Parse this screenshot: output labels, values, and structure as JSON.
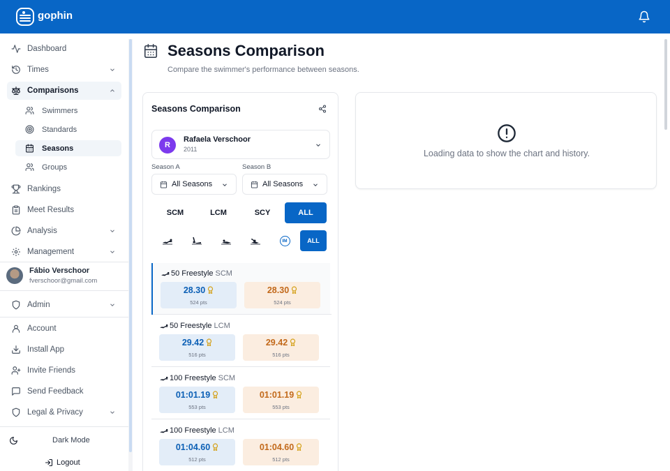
{
  "app": {
    "brand": "gophin"
  },
  "sidebar": {
    "items": [
      {
        "label": "Dashboard",
        "icon": "activity-icon"
      },
      {
        "label": "Times",
        "icon": "history-icon"
      },
      {
        "label": "Comparisons",
        "icon": "scale-icon"
      },
      {
        "label": "Rankings",
        "icon": "trophy-icon"
      },
      {
        "label": "Meet Results",
        "icon": "clipboard-icon"
      },
      {
        "label": "Analysis",
        "icon": "pie-chart-icon"
      },
      {
        "label": "Management",
        "icon": "gear-icon"
      }
    ],
    "sub_items": [
      {
        "label": "Swimmers",
        "icon": "users-icon"
      },
      {
        "label": "Standards",
        "icon": "target-icon"
      },
      {
        "label": "Seasons",
        "icon": "calendar-icon"
      },
      {
        "label": "Groups",
        "icon": "users-icon"
      }
    ],
    "user": {
      "name": "Fábio Verschoor",
      "email": "fverschoor@gmail.com"
    },
    "footer_items": [
      {
        "label": "Admin",
        "icon": "shield-icon"
      },
      {
        "label": "Account",
        "icon": "user-icon"
      },
      {
        "label": "Install App",
        "icon": "download-icon"
      },
      {
        "label": "Invite Friends",
        "icon": "user-plus-icon"
      },
      {
        "label": "Send Feedback",
        "icon": "message-icon"
      },
      {
        "label": "Legal & Privacy",
        "icon": "shield-icon"
      }
    ],
    "dark_mode": "Dark Mode",
    "logout": "Logout"
  },
  "page": {
    "title": "Seasons Comparison",
    "subtitle": "Compare the swimmer's performance between seasons."
  },
  "card": {
    "title": "Seasons Comparison",
    "swimmer": {
      "initial": "R",
      "name": "Rafaela Verschoor",
      "year": "2011"
    },
    "season_a": {
      "label": "Season A",
      "value": "All Seasons"
    },
    "season_b": {
      "label": "Season B",
      "value": "All Seasons"
    },
    "courses": [
      "SCM",
      "LCM",
      "SCY",
      "ALL"
    ],
    "stroke_all": "ALL",
    "stroke_im": "IM",
    "events": [
      {
        "name": "50 Freestyle",
        "course": "SCM",
        "a_time": "28.30",
        "a_pts": "524 pts",
        "b_time": "28.30",
        "b_pts": "524 pts"
      },
      {
        "name": "50 Freestyle",
        "course": "LCM",
        "a_time": "29.42",
        "a_pts": "516 pts",
        "b_time": "29.42",
        "b_pts": "516 pts"
      },
      {
        "name": "100 Freestyle",
        "course": "SCM",
        "a_time": "01:01.19",
        "a_pts": "553 pts",
        "b_time": "01:01.19",
        "b_pts": "553 pts"
      },
      {
        "name": "100 Freestyle",
        "course": "LCM",
        "a_time": "01:04.60",
        "a_pts": "512 pts",
        "b_time": "01:04.60",
        "b_pts": "512 pts"
      }
    ]
  },
  "chart_panel": {
    "message": "Loading data to show the chart and history."
  },
  "colors": {
    "primary": "#0866c6",
    "season_a_bg": "#e3edf8",
    "season_b_bg": "#fbede0",
    "avatar": "#7c3aed"
  }
}
